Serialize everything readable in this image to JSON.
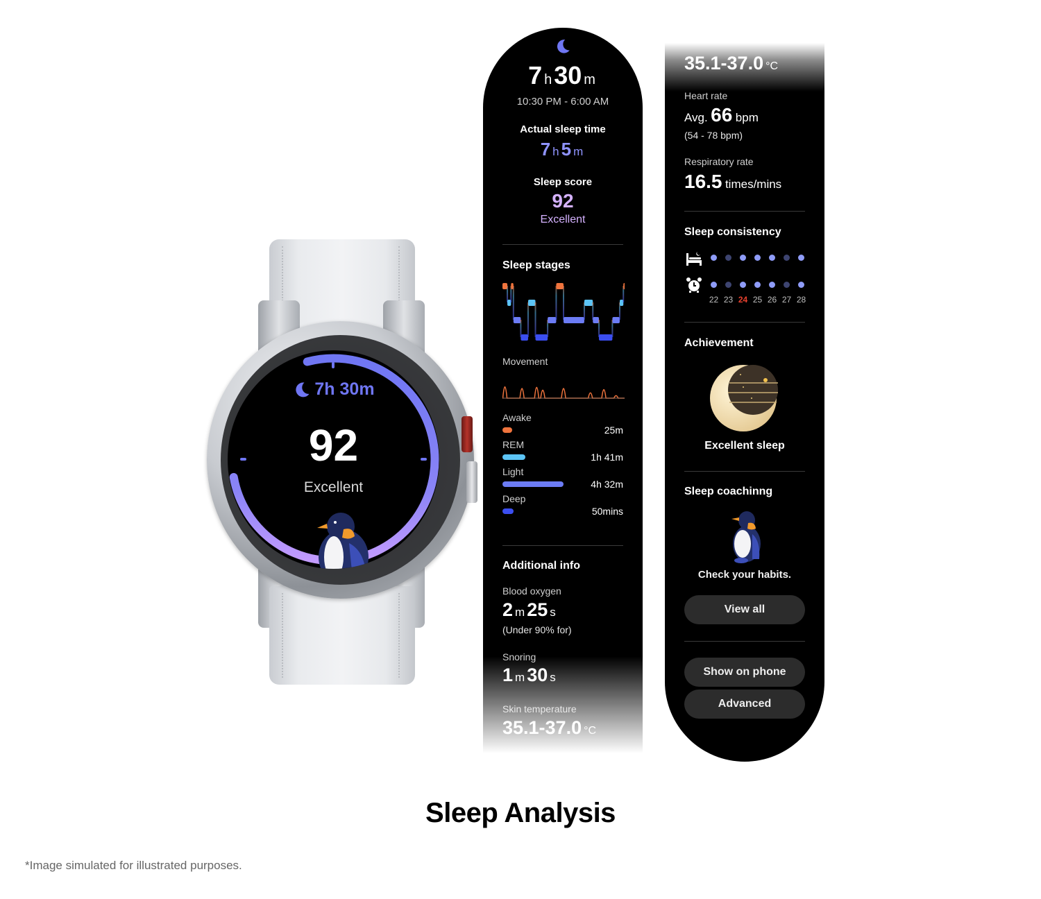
{
  "page": {
    "title": "Sleep Analysis",
    "disclaimer": "*Image simulated for illustrated purposes."
  },
  "watch_face": {
    "icon": "moon-icon",
    "duration": "7h 30m",
    "score": "92",
    "score_label": "Excellent",
    "score_fraction": 0.92,
    "accent_color": "#6f76f3",
    "arc_end_color": "#c39bff"
  },
  "panel_1": {
    "icon": "moon-icon",
    "total_hours": "7",
    "total_minutes": "30",
    "hour_unit": "h",
    "minute_unit": "m",
    "time_range": "10:30 PM - 6:00 AM",
    "actual_sleep_label": "Actual sleep time",
    "actual_hours": "7",
    "actual_minutes": "5",
    "sleep_score_label": "Sleep score",
    "sleep_score": "92",
    "sleep_score_rating": "Excellent",
    "sleep_stages_title": "Sleep stages",
    "movement_label": "Movement",
    "stages": [
      {
        "name": "Awake",
        "duration": "25m",
        "color": "#f0743d",
        "minutes": 25
      },
      {
        "name": "REM",
        "duration": "1h 41m",
        "color": "#5cc4f5",
        "minutes": 101
      },
      {
        "name": "Light",
        "duration": "4h 32m",
        "color": "#6c7cf5",
        "minutes": 272
      },
      {
        "name": "Deep",
        "duration": "50mins",
        "color": "#3b4ef0",
        "minutes": 50
      }
    ],
    "hypnogram": [
      [
        "Awake",
        0.0,
        0.04
      ],
      [
        "REM",
        0.04,
        0.07
      ],
      [
        "Awake",
        0.07,
        0.09
      ],
      [
        "Light",
        0.09,
        0.15
      ],
      [
        "Deep",
        0.15,
        0.21
      ],
      [
        "REM",
        0.21,
        0.27
      ],
      [
        "Deep",
        0.27,
        0.37
      ],
      [
        "Light",
        0.37,
        0.44
      ],
      [
        "Awake",
        0.44,
        0.5
      ],
      [
        "Light",
        0.5,
        0.67
      ],
      [
        "REM",
        0.67,
        0.74
      ],
      [
        "Light",
        0.74,
        0.79
      ],
      [
        "Deep",
        0.79,
        0.9
      ],
      [
        "Light",
        0.9,
        0.96
      ],
      [
        "REM",
        0.96,
        0.99
      ],
      [
        "Awake",
        0.99,
        1.0
      ]
    ],
    "movement_peaks": [
      [
        0.02,
        0.9
      ],
      [
        0.16,
        0.75
      ],
      [
        0.28,
        0.85
      ],
      [
        0.33,
        0.6
      ],
      [
        0.5,
        0.75
      ],
      [
        0.72,
        0.35
      ],
      [
        0.83,
        0.65
      ],
      [
        0.93,
        0.1
      ]
    ],
    "additional_info_title": "Additional info",
    "blood_oxygen_label": "Blood oxygen",
    "blood_oxygen_minutes": "2",
    "blood_oxygen_seconds": "25",
    "blood_oxygen_note": "(Under 90% for)",
    "snoring_label": "Snoring",
    "snoring_minutes": "1",
    "snoring_seconds": "30",
    "minute_short": "m",
    "second_short": "s",
    "skin_temp_label": "Skin temperature",
    "skin_temp_value": "35.1-37.0",
    "skin_temp_unit": "°C"
  },
  "panel_2": {
    "skin_temp_value": "35.1-37.0",
    "skin_temp_unit": "°C",
    "heart_rate_label": "Heart rate",
    "heart_rate_prefix": "Avg.",
    "heart_rate_value": "66",
    "heart_rate_unit": "bpm",
    "heart_rate_range": "(54 - 78 bpm)",
    "respiratory_label": "Respiratory rate",
    "respiratory_value": "16.5",
    "respiratory_unit": "times/mins",
    "consistency_title": "Sleep consistency",
    "bedtime_icon": "bed-icon",
    "wake_icon": "alarm-clock-icon",
    "days": [
      "22",
      "23",
      "24",
      "25",
      "26",
      "27",
      "28"
    ],
    "highlight_day": "24",
    "highlight_color": "#e8412e",
    "bedtime_consistent": [
      true,
      false,
      true,
      true,
      true,
      false,
      true
    ],
    "wake_consistent": [
      true,
      false,
      true,
      true,
      true,
      false,
      true
    ],
    "achievement_title": "Achievement",
    "achievement_badge": "crescent-moon-badge",
    "achievement_label": "Excellent sleep",
    "coaching_title": "Sleep coachinng",
    "coaching_mascot": "penguin",
    "coaching_text": "Check your habits.",
    "view_all": "View all",
    "show_on_phone": "Show on phone",
    "advanced": "Advanced"
  }
}
